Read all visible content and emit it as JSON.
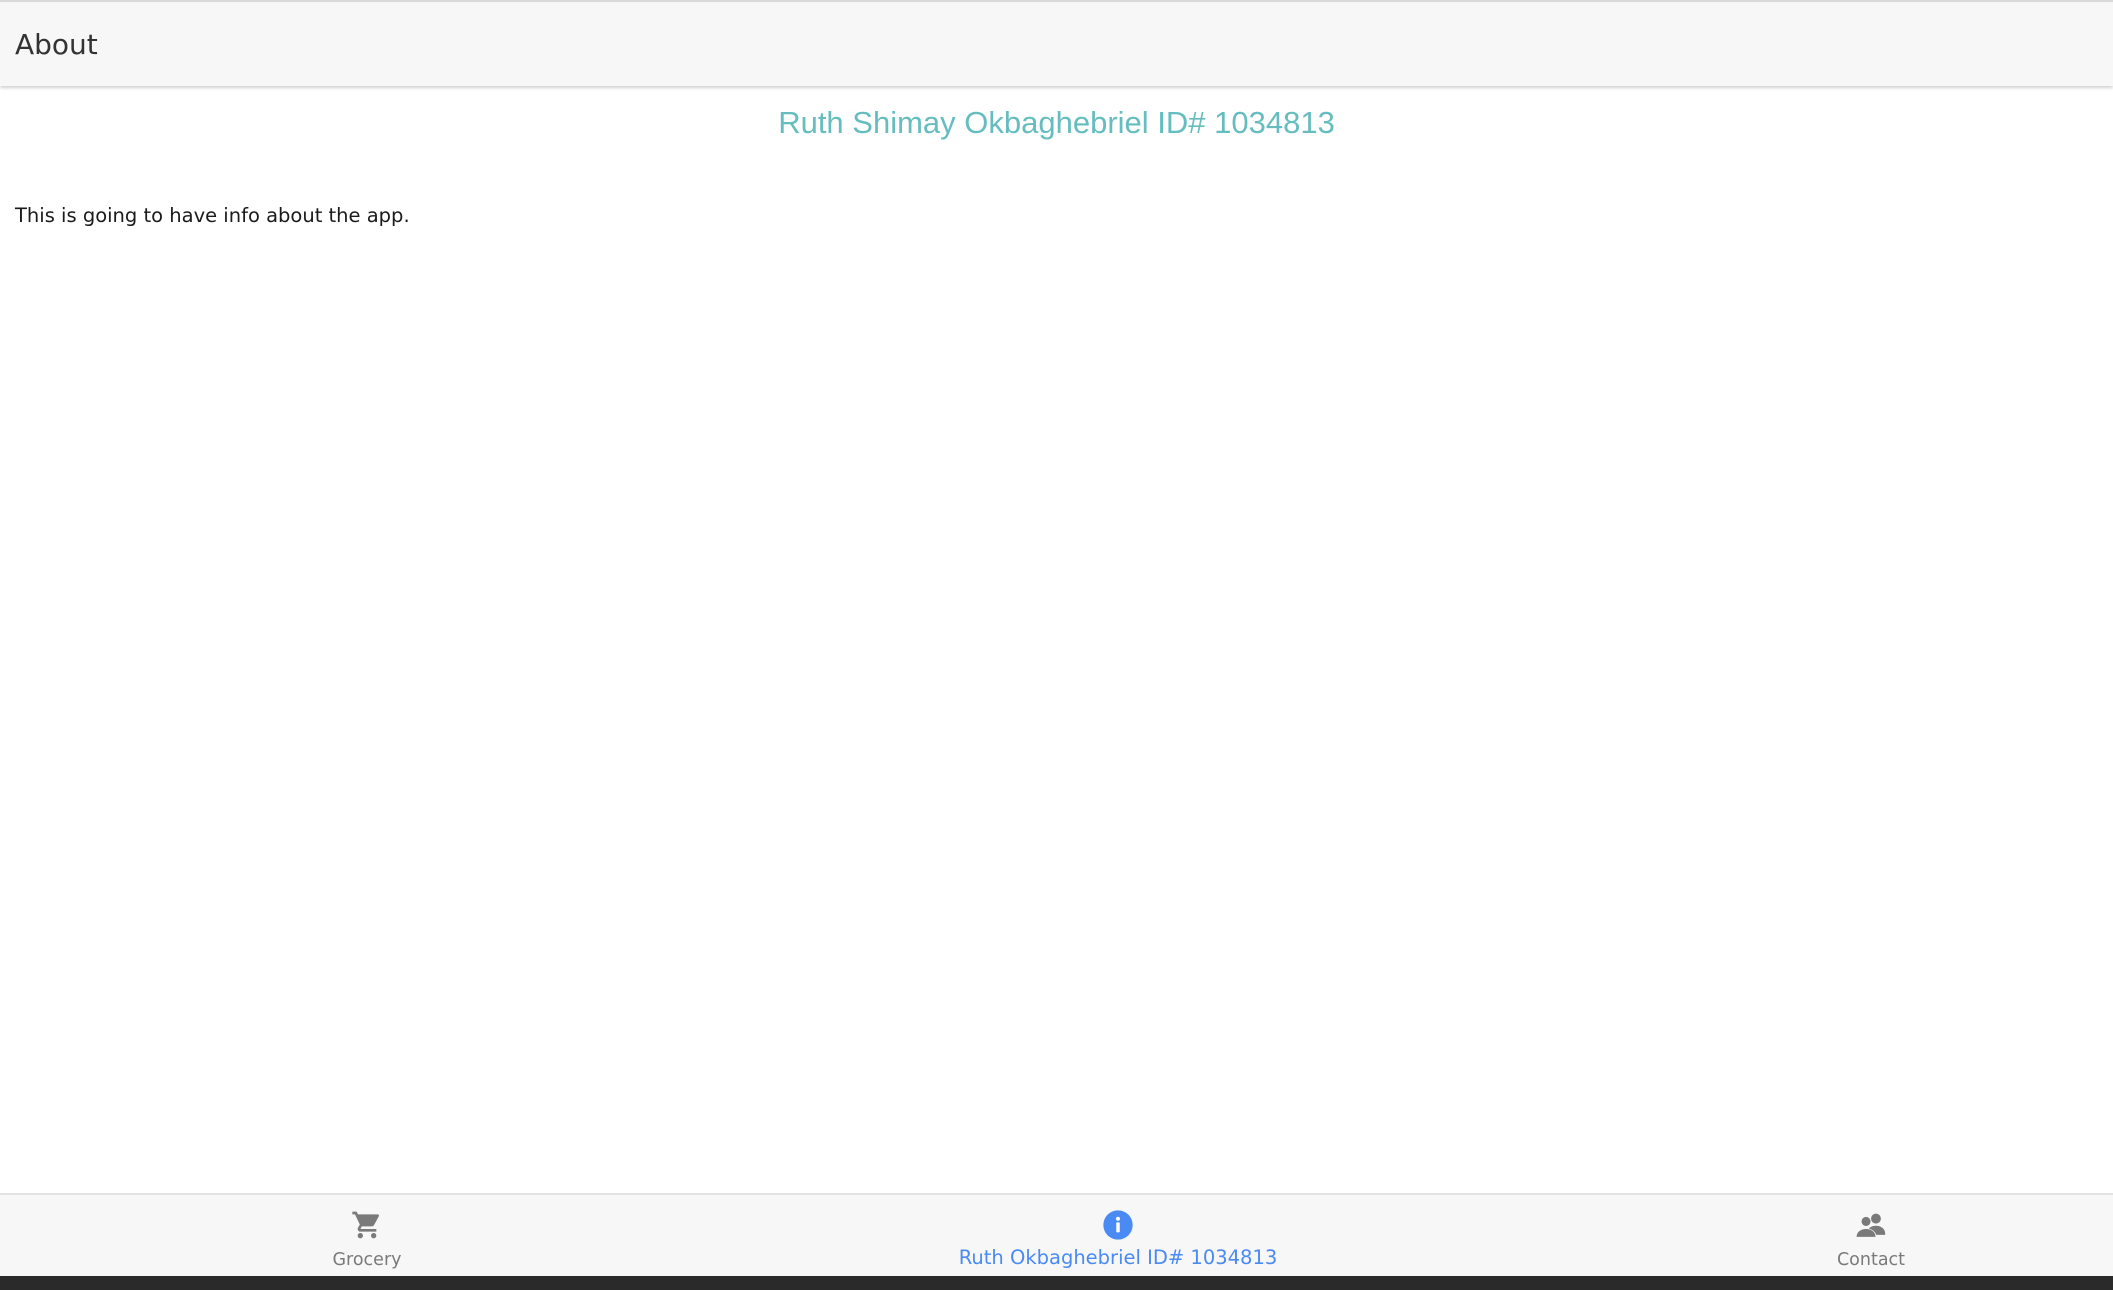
{
  "header": {
    "title": "About"
  },
  "content": {
    "heading": "Ruth Shimay Okbaghebriel ID# 1034813",
    "body_text": "This is going to have info about the app."
  },
  "tabs": [
    {
      "label": "Grocery",
      "icon": "cart-icon",
      "active": false
    },
    {
      "label": "Ruth Okbaghebriel ID# 1034813",
      "icon": "info-icon",
      "active": true
    },
    {
      "label": "Contact",
      "icon": "people-icon",
      "active": false
    }
  ],
  "colors": {
    "accent": "#4a8af4",
    "heading": "#66bdbf",
    "inactive": "#7a7a7a",
    "bar_bg": "#f7f7f7"
  }
}
